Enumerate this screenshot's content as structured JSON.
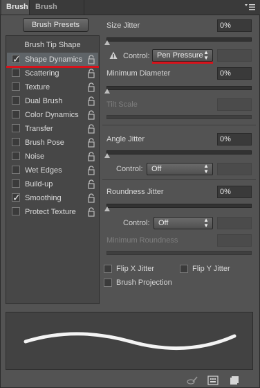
{
  "tabs": [
    "Brush",
    "Brush Presets"
  ],
  "left": {
    "presets_button": "Brush Presets",
    "list_header": "Brush Tip Shape",
    "items": [
      {
        "label": "Shape Dynamics",
        "checked": true,
        "selected": true
      },
      {
        "label": "Scattering",
        "checked": false
      },
      {
        "label": "Texture",
        "checked": false
      },
      {
        "label": "Dual Brush",
        "checked": false
      },
      {
        "label": "Color Dynamics",
        "checked": false
      },
      {
        "label": "Transfer",
        "checked": false
      },
      {
        "label": "Brush Pose",
        "checked": false
      },
      {
        "label": "Noise",
        "checked": false
      },
      {
        "label": "Wet Edges",
        "checked": false
      },
      {
        "label": "Build-up",
        "checked": false
      },
      {
        "label": "Smoothing",
        "checked": true
      },
      {
        "label": "Protect Texture",
        "checked": false
      }
    ]
  },
  "right": {
    "size_jitter": {
      "label": "Size Jitter",
      "value": "0%"
    },
    "size_control": {
      "label": "Control:",
      "value": "Pen Pressure"
    },
    "min_diameter": {
      "label": "Minimum Diameter",
      "value": "0%"
    },
    "tilt_scale": {
      "label": "Tilt Scale"
    },
    "angle_jitter": {
      "label": "Angle Jitter",
      "value": "0%"
    },
    "angle_control": {
      "label": "Control:",
      "value": "Off"
    },
    "roundness_jitter": {
      "label": "Roundness Jitter",
      "value": "0%"
    },
    "roundness_control": {
      "label": "Control:",
      "value": "Off"
    },
    "min_roundness": {
      "label": "Minimum Roundness"
    },
    "flip_x": "Flip X Jitter",
    "flip_y": "Flip Y Jitter",
    "brush_projection": "Brush Projection"
  },
  "colors": {
    "accent_red": "#d8121b",
    "panel": "#535353"
  }
}
